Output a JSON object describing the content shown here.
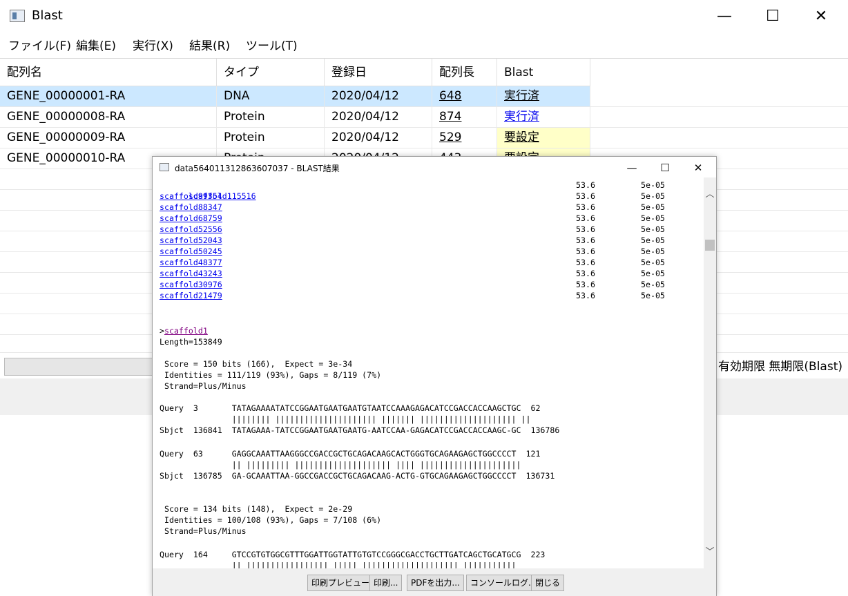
{
  "main": {
    "title": "Blast",
    "controls": {
      "min": "—",
      "max": "☐",
      "close": "✕"
    },
    "menu": [
      "ファイル(F)",
      "編集(E)",
      "実行(X)",
      "結果(R)",
      "ツール(T)"
    ],
    "columns": [
      "配列名",
      "タイプ",
      "登録日",
      "配列長",
      "Blast"
    ],
    "rows": [
      {
        "name": "GENE_00000001-RA",
        "type": "DNA",
        "date": "2020/04/12",
        "length": "648",
        "blast": "実行済"
      },
      {
        "name": "GENE_00000008-RA",
        "type": "Protein",
        "date": "2020/04/12",
        "length": "874",
        "blast": "実行済"
      },
      {
        "name": "GENE_00000009-RA",
        "type": "Protein",
        "date": "2020/04/12",
        "length": "529",
        "blast": "要設定"
      },
      {
        "name": "GENE_00000010-RA",
        "type": "Protein",
        "date": "2020/04/12",
        "length": "443",
        "blast": "要設定"
      }
    ],
    "status": "有効期限 無期限(Blast)"
  },
  "dialog": {
    "title": "data564011312863607037 - BLAST結果",
    "controls": {
      "min": "—",
      "max": "☐",
      "close": "✕"
    },
    "hits": [
      {
        "name": "scaffold115516",
        "score": "53.6",
        "evalue": "5e-05"
      },
      {
        "name": "scaffold99354",
        "score": "53.6",
        "evalue": "5e-05"
      },
      {
        "name": "scaffold88347",
        "score": "53.6",
        "evalue": "5e-05"
      },
      {
        "name": "scaffold68759",
        "score": "53.6",
        "evalue": "5e-05"
      },
      {
        "name": "scaffold52556",
        "score": "53.6",
        "evalue": "5e-05"
      },
      {
        "name": "scaffold52043",
        "score": "53.6",
        "evalue": "5e-05"
      },
      {
        "name": "scaffold50245",
        "score": "53.6",
        "evalue": "5e-05"
      },
      {
        "name": "scaffold48377",
        "score": "53.6",
        "evalue": "5e-05"
      },
      {
        "name": "scaffold43243",
        "score": "53.6",
        "evalue": "5e-05"
      },
      {
        "name": "scaffold30976",
        "score": "53.6",
        "evalue": "5e-05"
      },
      {
        "name": "scaffold21479",
        "score": "53.6",
        "evalue": "5e-05"
      }
    ],
    "detail": {
      "prefix": ">",
      "scaffold": "scaffold1",
      "length": "Length=153849",
      "hsp1": {
        "score": " Score = 150 bits (166),  Expect = 3e-34",
        "identities": " Identities = 111/119 (93%), Gaps = 8/119 (7%)",
        "strand": " Strand=Plus/Minus"
      },
      "aln1": [
        "Query  3       TATAGAAAATATCCGGAATGAATGAATGTAATCCAAAGAGACATCCGACCACCAAGCTGC  62",
        "               |||||||| ||||||||||||||||||||| ||||||| |||||||||||||||||||| ||",
        "Sbjct  136841  TATAGAAA-TATCCGGAATGAATGAATG-AATCCAA-GAGACATCCGACCACCAAGC-GC  136786"
      ],
      "aln2": [
        "Query  63      GAGGCAAATTAAGGGCCGACCGCTGCAGACAAGCACTGGGTGCAGAAGAGCTGGCCCCT  121",
        "               || ||||||||| |||||||||||||||||||| |||| |||||||||||||||||||||",
        "Sbjct  136785  GA-GCAAATTAA-GGCCGACCGCTGCAGACAAG-ACTG-GTGCAGAAGAGCTGGCCCCT  136731"
      ],
      "hsp2": {
        "score": " Score = 134 bits (148),  Expect = 2e-29",
        "identities": " Identities = 100/108 (93%), Gaps = 7/108 (6%)",
        "strand": " Strand=Plus/Minus"
      },
      "aln3": [
        "Query  164     GTCCGTGTGGCGTTTGGATTGGTATTGTGTCCGGGCGACCTGCTTGATCAGCTGCATGCG  223",
        "               || ||||||||||||||||| ||||| |||||||||||||||||||| |||||||||||"
      ]
    },
    "buttons": [
      "印刷プレビュー",
      "印刷...",
      "PDFを出力...",
      "コンソールログ...",
      "閉じる"
    ]
  }
}
